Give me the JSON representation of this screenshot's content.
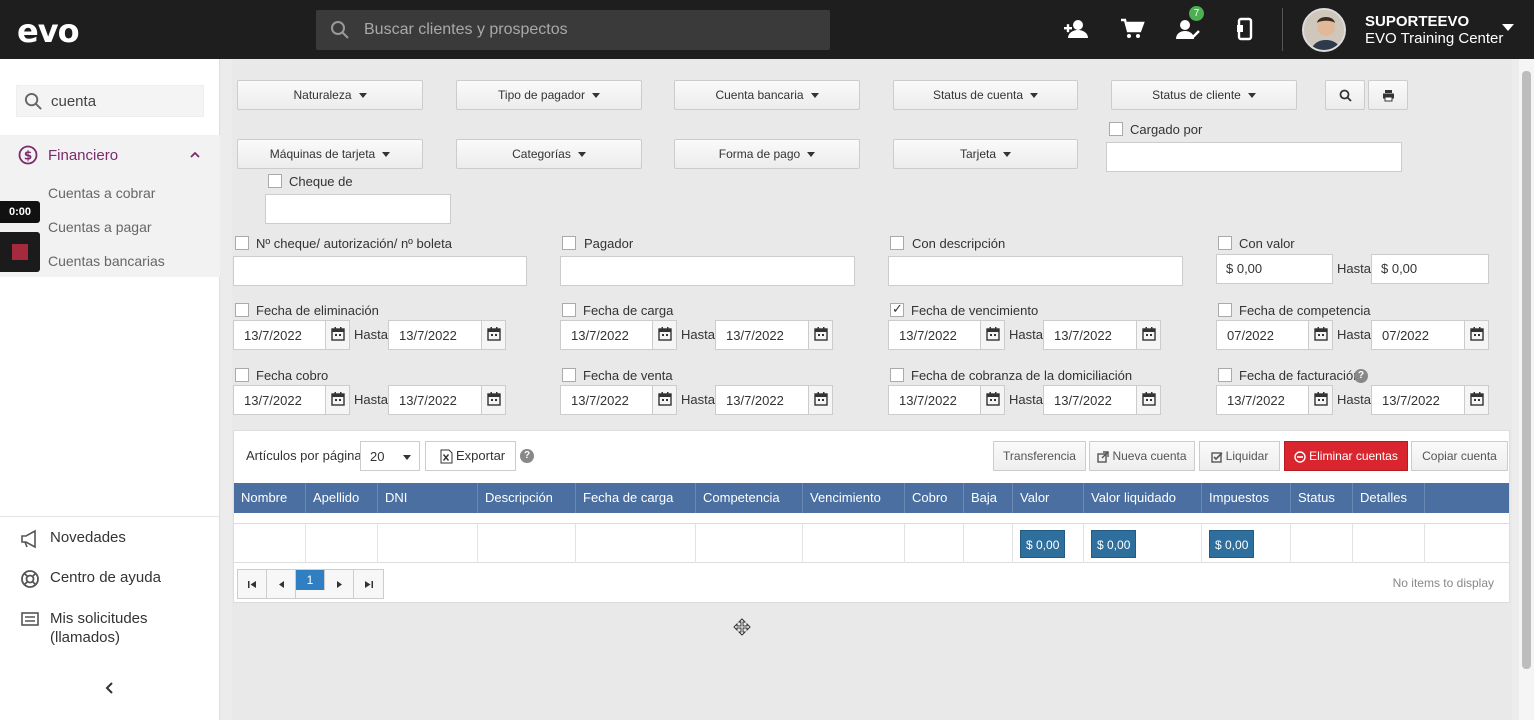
{
  "header": {
    "logo": "evo",
    "search_placeholder": "Buscar clientes y prospectos",
    "notification_count": "7",
    "user_name": "SUPORTEEVO",
    "user_org": "EVO Training Center"
  },
  "sidebar": {
    "search_value": "cuenta",
    "group_label": "Financiero",
    "sub_items": [
      "Cuentas a cobrar",
      "Cuentas a pagar",
      "Cuentas bancarias"
    ],
    "timer": "0:00",
    "links": [
      "Novedades",
      "Centro de ayuda",
      "Mis solicitudes (llamados)"
    ]
  },
  "filters": {
    "dropdowns_row1": [
      "Naturaleza",
      "Tipo de pagador",
      "Cuenta bancaria",
      "Status de cuenta",
      "Status de cliente"
    ],
    "dropdowns_row2": [
      "Máquinas de tarjeta",
      "Categorías",
      "Forma de pago",
      "Tarjeta"
    ],
    "cargado_por": "Cargado por",
    "cheque_de": "Cheque de",
    "n_cheque": "Nº cheque/ autorización/ nº boleta",
    "pagador": "Pagador",
    "con_descripcion": "Con descripción",
    "con_valor": "Con valor",
    "valor_desde": "$ 0,00",
    "valor_hasta": "$ 0,00",
    "hasta": "Hasta",
    "date_filters": [
      {
        "label": "Fecha de eliminación",
        "from": "13/7/2022",
        "to": "13/7/2022",
        "checked": false
      },
      {
        "label": "Fecha de carga",
        "from": "13/7/2022",
        "to": "13/7/2022",
        "checked": false
      },
      {
        "label": "Fecha de vencimiento",
        "from": "13/7/2022",
        "to": "13/7/2022",
        "checked": true
      },
      {
        "label": "Fecha de competencia",
        "from": "07/2022",
        "to": "07/2022",
        "checked": false
      },
      {
        "label": "Fecha cobro",
        "from": "13/7/2022",
        "to": "13/7/2022",
        "checked": false
      },
      {
        "label": "Fecha de venta",
        "from": "13/7/2022",
        "to": "13/7/2022",
        "checked": false
      },
      {
        "label": "Fecha de cobranza de la domiciliación",
        "from": "13/7/2022",
        "to": "13/7/2022",
        "checked": false
      },
      {
        "label": "Fecha de facturación",
        "from": "13/7/2022",
        "to": "13/7/2022",
        "checked": false
      }
    ]
  },
  "grid": {
    "per_page_label": "Artículos por página:",
    "per_page_value": "20",
    "export_label": "Exportar",
    "actions": [
      "Transferencia",
      "Nueva cuenta",
      "Liquidar",
      "Eliminar cuentas",
      "Copiar cuenta"
    ],
    "columns": [
      "Nombre",
      "Apellido",
      "DNI",
      "Descripción",
      "Fecha de carga",
      "Competencia",
      "Vencimiento",
      "Cobro",
      "Baja",
      "Valor",
      "Valor liquidado",
      "Impuestos",
      "Status",
      "Detalles"
    ],
    "totals": {
      "valor": "$ 0,00",
      "valor_liquidado": "$ 0,00",
      "impuestos": "$ 0,00"
    },
    "current_page": "1",
    "empty_text": "No items to display"
  },
  "colors": {
    "topbar": "#1e1e1e",
    "accent": "#7b2a6b",
    "table_header": "#4a6fa0",
    "danger": "#d9262e",
    "money": "#2f6f9e",
    "badge": "#4caf50"
  }
}
